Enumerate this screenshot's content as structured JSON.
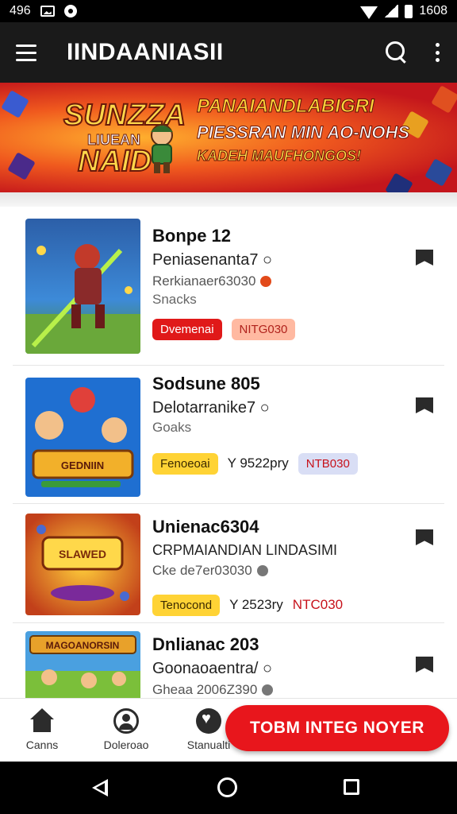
{
  "status_bar": {
    "left_text": "496",
    "time": "1608",
    "icons": [
      "image-icon",
      "circle-notification-icon",
      "wifi-icon",
      "signal-icon",
      "battery-icon"
    ]
  },
  "app_bar": {
    "title": "IINDAANIASII",
    "icons": [
      "menu-icon",
      "search-icon",
      "more-vert-icon"
    ]
  },
  "banner": {
    "logo_line1": "SUNZZA",
    "logo_line2": "LIUEAN",
    "logo_line3": "NAID",
    "line1": "PANAIANDLABIGRI",
    "line2": "PIESSRAN MIN AO-NOHS",
    "line3": "KADEH MAUFHONGOS!"
  },
  "games": [
    {
      "title": "Bonpe 12",
      "subtitle": "Peniasenanta7",
      "developer": "Rerkianaer63030",
      "genre": "Snacks",
      "tags": [
        "Dvemenai",
        "NITG030"
      ],
      "thumb_colors": [
        "#2c5fa8",
        "#8ad04b",
        "#c23a2a"
      ]
    },
    {
      "title": "Sodsune 805",
      "subtitle": "Delotarranike7",
      "developer": "",
      "genre": "Goaks",
      "tags": [
        "Fenoeoai",
        "Y 9522pry",
        "NTB030"
      ],
      "thumb_colors": [
        "#1f6fd1",
        "#f2b02a",
        "#c7302a"
      ]
    },
    {
      "title": "Unienac6304",
      "subtitle": "CRPMAIANDIAN LINDASIMI",
      "developer": "Cke de7er03030",
      "genre": "",
      "tags": [
        "Tenocond",
        "Y 2523ry",
        "NTC030"
      ],
      "thumb_colors": [
        "#e0621e",
        "#ffcf3a",
        "#7a2a9a"
      ]
    },
    {
      "title": "Dnlianac 203",
      "subtitle": "Goonaoaentra/",
      "developer": "Gheaa 2006Z390",
      "genre": "",
      "tags": [],
      "thumb_colors": [
        "#4aa0e0",
        "#7bbf3a",
        "#e8a12a"
      ]
    }
  ],
  "bottom_nav": {
    "items": [
      {
        "label": "Canns",
        "icon": "home-icon"
      },
      {
        "label": "Doleroao",
        "icon": "profile-icon"
      },
      {
        "label": "Stanualti",
        "icon": "heart-icon"
      }
    ],
    "cta_label": "TOBM INTEG NOYER"
  },
  "colors": {
    "accent_red": "#e8161c",
    "app_bar": "#1a1a1a",
    "tag_yellow": "#ffd335"
  }
}
